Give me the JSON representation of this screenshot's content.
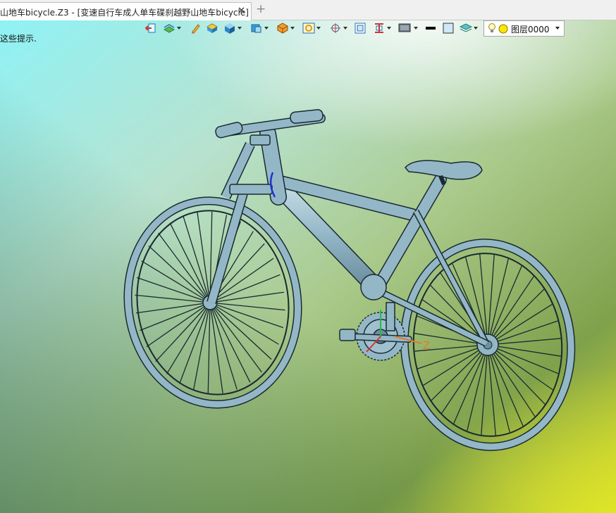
{
  "tab": {
    "title": "山地车bicycle.Z3 - [变速自行车成人单车碟刹越野山地车bicycle]",
    "close_glyph": "✕",
    "new_tab_glyph": "+"
  },
  "viewport": {
    "hint_text": "这些提示."
  },
  "toolbar": {
    "icons": [
      "exit-sketch-icon",
      "layers-icon",
      "pencil-icon",
      "box-top-icon",
      "solid-cube-icon",
      "cube-view-icon",
      "render-mode-icon",
      "zoom-target-icon",
      "axis-icon",
      "fit-frame-icon",
      "section-icon",
      "display-icon",
      "line-color-swatch",
      "fill-color-swatch",
      "plane-layers-icon"
    ]
  },
  "layer_selector": {
    "value": "图层0000",
    "icons": [
      "lightbulb-icon",
      "yellow-dot-icon"
    ]
  },
  "axis": {
    "z_label": "Z"
  },
  "colors": {
    "bike_body": "#94b7c7",
    "bike_outline": "#1a2a30",
    "axis_z": "#e07a2a"
  }
}
